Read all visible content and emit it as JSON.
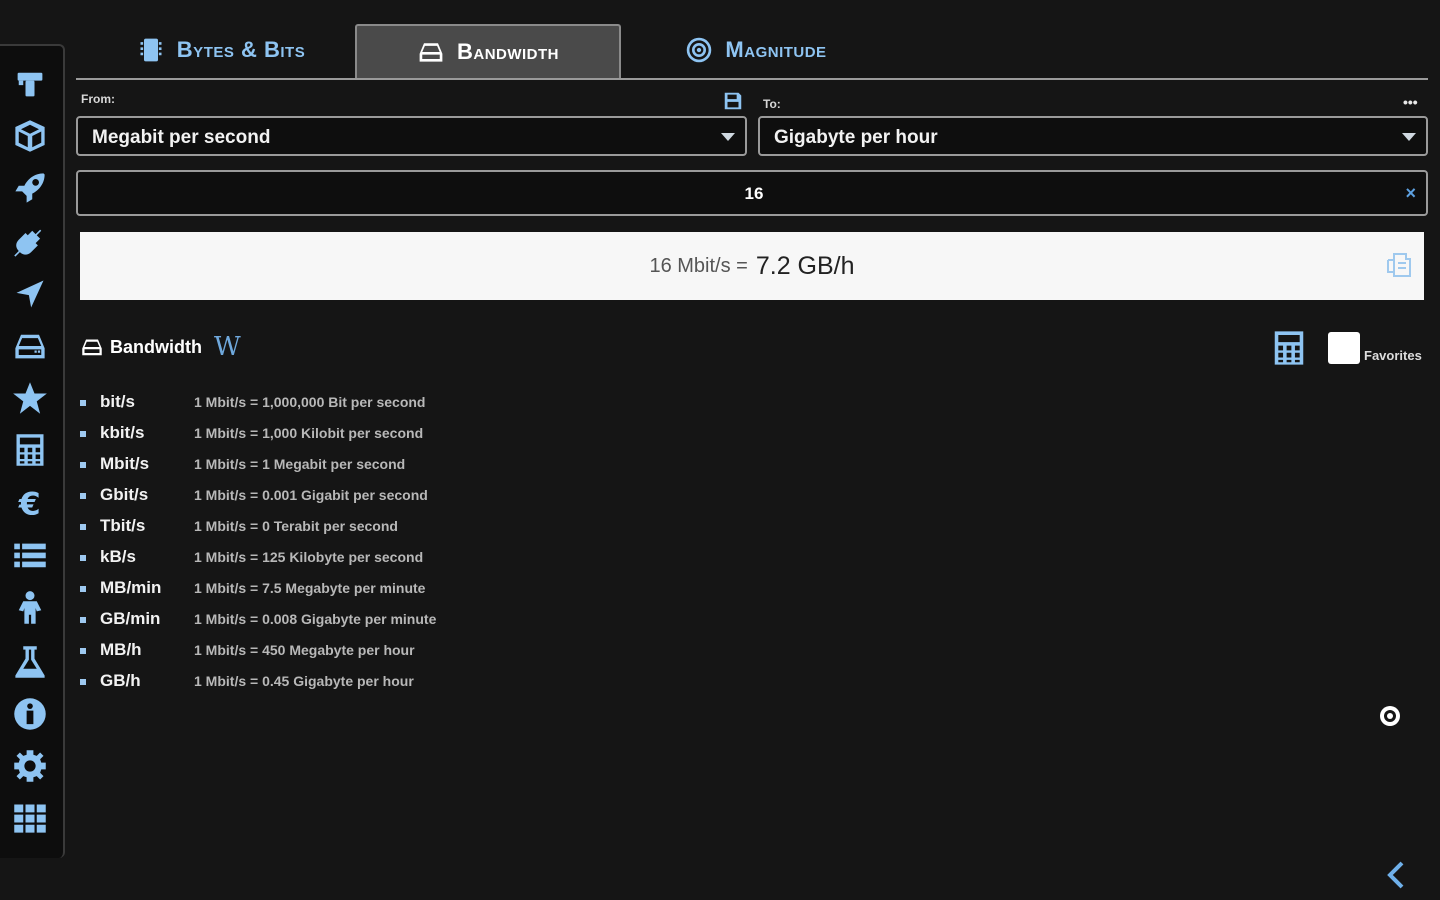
{
  "sidebar": {
    "items": [
      {
        "name": "length"
      },
      {
        "name": "volume"
      },
      {
        "name": "speed"
      },
      {
        "name": "power"
      },
      {
        "name": "navigation"
      },
      {
        "name": "data"
      },
      {
        "name": "favorites"
      },
      {
        "name": "calculator"
      },
      {
        "name": "currency"
      },
      {
        "name": "list"
      },
      {
        "name": "body"
      },
      {
        "name": "science"
      },
      {
        "name": "info"
      },
      {
        "name": "settings"
      },
      {
        "name": "apps"
      }
    ]
  },
  "tabs": [
    {
      "label": "Bytes & Bits",
      "icon": "chip-icon",
      "active": false
    },
    {
      "label": "Bandwidth",
      "icon": "drive-icon",
      "active": true
    },
    {
      "label": "Magnitude",
      "icon": "target-icon",
      "active": false
    }
  ],
  "converter": {
    "from_label": "From:",
    "to_label": "To:",
    "from_unit": "Megabit per second",
    "to_unit": "Gigabyte per hour",
    "input_value": "16",
    "clear_symbol": "×",
    "result_lhs": "16 Mbit/s =",
    "result_rhs": "7.2 GB/h"
  },
  "section": {
    "title": "Bandwidth",
    "wiki": "W",
    "favorites_label": "Favorites"
  },
  "units": [
    {
      "unit": "bit/s",
      "desc": "1 Mbit/s = 1,000,000 Bit per second"
    },
    {
      "unit": "kbit/s",
      "desc": "1 Mbit/s = 1,000 Kilobit per second"
    },
    {
      "unit": "Mbit/s",
      "desc": "1 Mbit/s = 1 Megabit per second"
    },
    {
      "unit": "Gbit/s",
      "desc": "1 Mbit/s = 0.001 Gigabit per second"
    },
    {
      "unit": "Tbit/s",
      "desc": "1 Mbit/s = 0 Terabit per second"
    },
    {
      "unit": "kB/s",
      "desc": "1 Mbit/s = 125 Kilobyte per second"
    },
    {
      "unit": "MB/min",
      "desc": "1 Mbit/s = 7.5 Megabyte per minute"
    },
    {
      "unit": "GB/min",
      "desc": "1 Mbit/s = 0.008 Gigabyte per minute"
    },
    {
      "unit": "MB/h",
      "desc": "1 Mbit/s = 450 Megabyte per hour"
    },
    {
      "unit": "GB/h",
      "desc": "1 Mbit/s = 0.45 Gigabyte per hour"
    }
  ],
  "colors": {
    "accent": "#8ec4f2",
    "background": "#151515",
    "result_bg": "#f7f7f7"
  }
}
